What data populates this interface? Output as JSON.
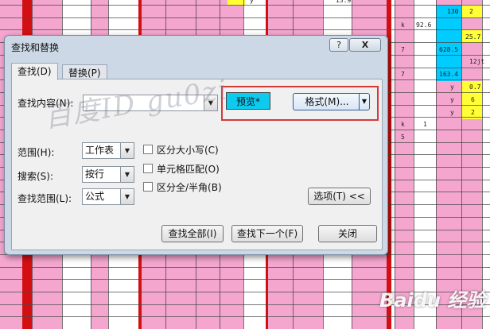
{
  "dialog": {
    "title": "查找和替换",
    "help_label": "?",
    "close_label": "X"
  },
  "tabs": [
    {
      "label": "查找(D)",
      "active": true
    },
    {
      "label": "替换(P)",
      "active": false
    }
  ],
  "find": {
    "label": "查找内容(N):",
    "value": "",
    "dropdown_arrow": "▼",
    "preview_label": "预览*",
    "preview_color": "#0ccbef",
    "format_label": "格式(M)...",
    "format_arrow": "▼"
  },
  "options": {
    "within": {
      "label": "范围(H):",
      "value": "工作表"
    },
    "search": {
      "label": "搜索(S):",
      "value": "按行"
    },
    "look_in": {
      "label": "查找范围(L):",
      "value": "公式"
    },
    "checkboxes": [
      {
        "label": "区分大小写(C)",
        "checked": false
      },
      {
        "label": "单元格匹配(O)",
        "checked": false
      },
      {
        "label": "区分全/半角(B)",
        "checked": false
      }
    ],
    "options_button": "选项(T) <<"
  },
  "buttons": {
    "find_all": "查找全部(I)",
    "find_next": "查找下一个(F)",
    "close": "关闭"
  },
  "sheet_cells": [
    "y",
    "13.9",
    "130",
    "2",
    "k",
    "92.6",
    "25.7",
    "7",
    "628.5",
    "12jt",
    "7",
    "163.4",
    "y",
    "0.7",
    "y",
    "6",
    "y",
    "2",
    "k",
    "1",
    "5"
  ],
  "watermark": {
    "text": "百度ID gu0zi",
    "brand": "Baidu 经验"
  },
  "colors": {
    "sheet_pink": "#f4a6cf",
    "sheet_red": "#d40f12",
    "sheet_yellow": "#ffff33",
    "sheet_cyan": "#00ccff",
    "highlight_red": "#d23a3a",
    "dialog_frame": "#ccd8e6"
  }
}
